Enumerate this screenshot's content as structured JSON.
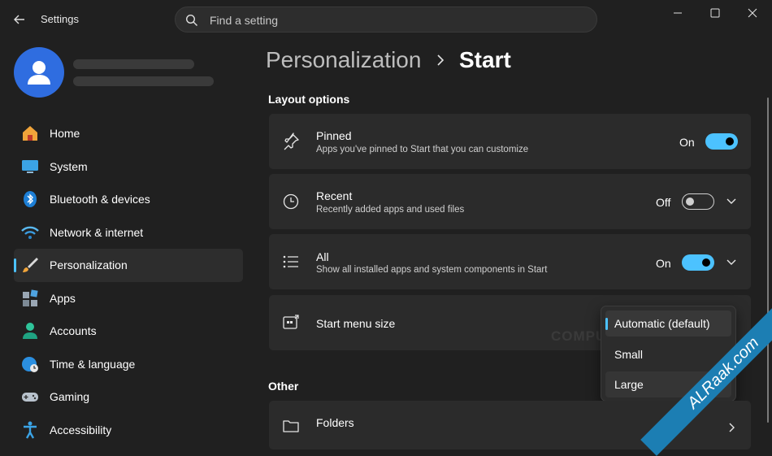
{
  "window": {
    "title": "Settings",
    "search_placeholder": "Find a setting"
  },
  "sidebar": {
    "items": [
      {
        "label": "Home",
        "icon": "home-icon"
      },
      {
        "label": "System",
        "icon": "monitor-icon"
      },
      {
        "label": "Bluetooth & devices",
        "icon": "bluetooth-icon"
      },
      {
        "label": "Network & internet",
        "icon": "wifi-icon"
      },
      {
        "label": "Personalization",
        "icon": "brush-icon",
        "selected": true
      },
      {
        "label": "Apps",
        "icon": "apps-icon"
      },
      {
        "label": "Accounts",
        "icon": "person-icon"
      },
      {
        "label": "Time & language",
        "icon": "globe-clock-icon"
      },
      {
        "label": "Gaming",
        "icon": "gamepad-icon"
      },
      {
        "label": "Accessibility",
        "icon": "accessibility-icon"
      }
    ]
  },
  "header": {
    "breadcrumb_parent": "Personalization",
    "breadcrumb_current": "Start"
  },
  "layout_options": {
    "title": "Layout options",
    "pinned": {
      "title": "Pinned",
      "subtitle": "Apps you've pinned to Start that you can customize",
      "state": "On",
      "on": true
    },
    "recent": {
      "title": "Recent",
      "subtitle": "Recently added apps and used files",
      "state": "Off",
      "on": false
    },
    "all": {
      "title": "All",
      "subtitle": "Show all installed apps and system components in Start",
      "state": "On",
      "on": true
    },
    "size": {
      "title": "Start menu size",
      "options": [
        "Automatic (default)",
        "Small",
        "Large"
      ],
      "selected": "Automatic (default)"
    }
  },
  "other": {
    "title": "Other",
    "folders": {
      "title": "Folders"
    }
  },
  "watermarks": {
    "center": "COMPUTERWORLD.COM",
    "corner": "ALRaak.com"
  },
  "colors": {
    "accent": "#4cc2ff",
    "background": "#202020",
    "card": "#2b2b2b"
  }
}
